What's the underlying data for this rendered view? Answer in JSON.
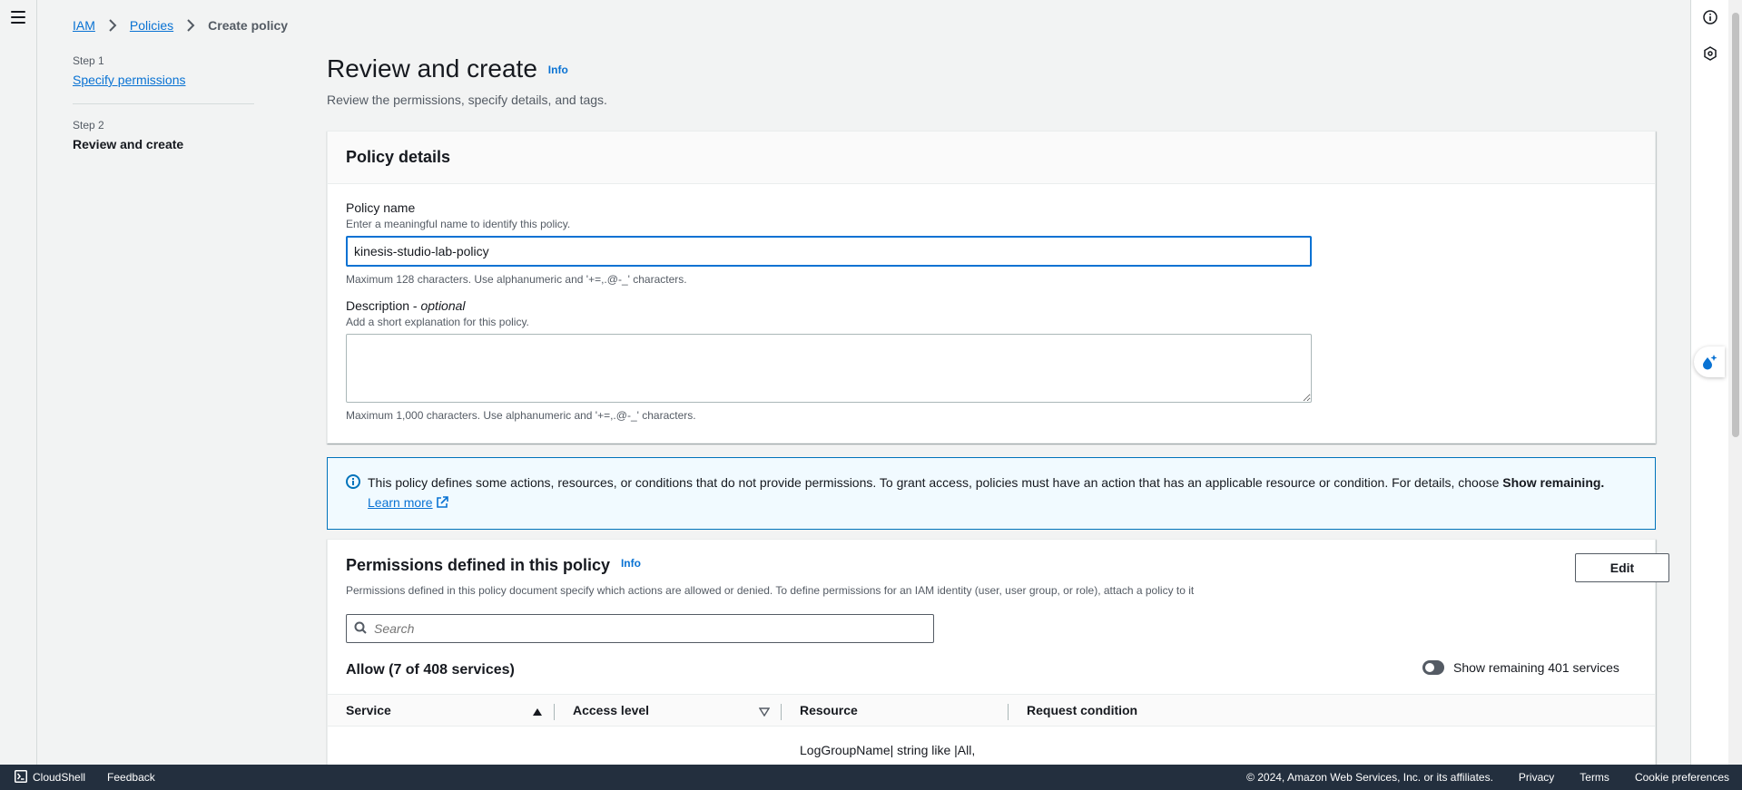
{
  "breadcrumb": {
    "items": [
      "IAM",
      "Policies"
    ],
    "current": "Create policy"
  },
  "steps": {
    "step1_label": "Step 1",
    "step1_link": "Specify permissions",
    "step2_label": "Step 2",
    "step2_current": "Review and create"
  },
  "header": {
    "title": "Review and create",
    "info": "Info",
    "description": "Review the permissions, specify details, and tags."
  },
  "policy_details": {
    "title": "Policy details",
    "name_label": "Policy name",
    "name_desc": "Enter a meaningful name to identify this policy.",
    "name_value": "kinesis-studio-lab-policy",
    "name_constraint": "Maximum 128 characters. Use alphanumeric and '+=,.@-_' characters.",
    "desc_label": "Description",
    "desc_optional_sep": " - ",
    "desc_optional": "optional",
    "desc_desc": "Add a short explanation for this policy.",
    "desc_constraint": "Maximum 1,000 characters. Use alphanumeric and '+=,.@-_' characters."
  },
  "alert": {
    "text": "This policy defines some actions, resources, or conditions that do not provide permissions. To grant access, policies must have an action that has an applicable resource or condition. For details, choose ",
    "bold": "Show remaining.",
    "link": "Learn more"
  },
  "permissions": {
    "title": "Permissions defined in this policy",
    "info": "Info",
    "description": "Permissions defined in this policy document specify which actions are allowed or denied. To define permissions for an IAM identity (user, user group, or role), attach a policy to it",
    "edit_label": "Edit",
    "search_placeholder": "Search",
    "allow_title": "Allow (7 of 408 services)",
    "toggle_label": "Show remaining 401 services",
    "columns": [
      "Service",
      "Access level",
      "Resource",
      "Request condition"
    ],
    "first_row_resource": "LogGroupName| string like |All,"
  },
  "footer": {
    "cloudshell": "CloudShell",
    "feedback": "Feedback",
    "copyright": "© 2024, Amazon Web Services, Inc. or its affiliates.",
    "privacy": "Privacy",
    "terms": "Terms",
    "cookies": "Cookie preferences"
  },
  "colors": {
    "accent": "#0972d3",
    "footer_bg": "#232f3e",
    "alert_bg": "#f1faff"
  }
}
